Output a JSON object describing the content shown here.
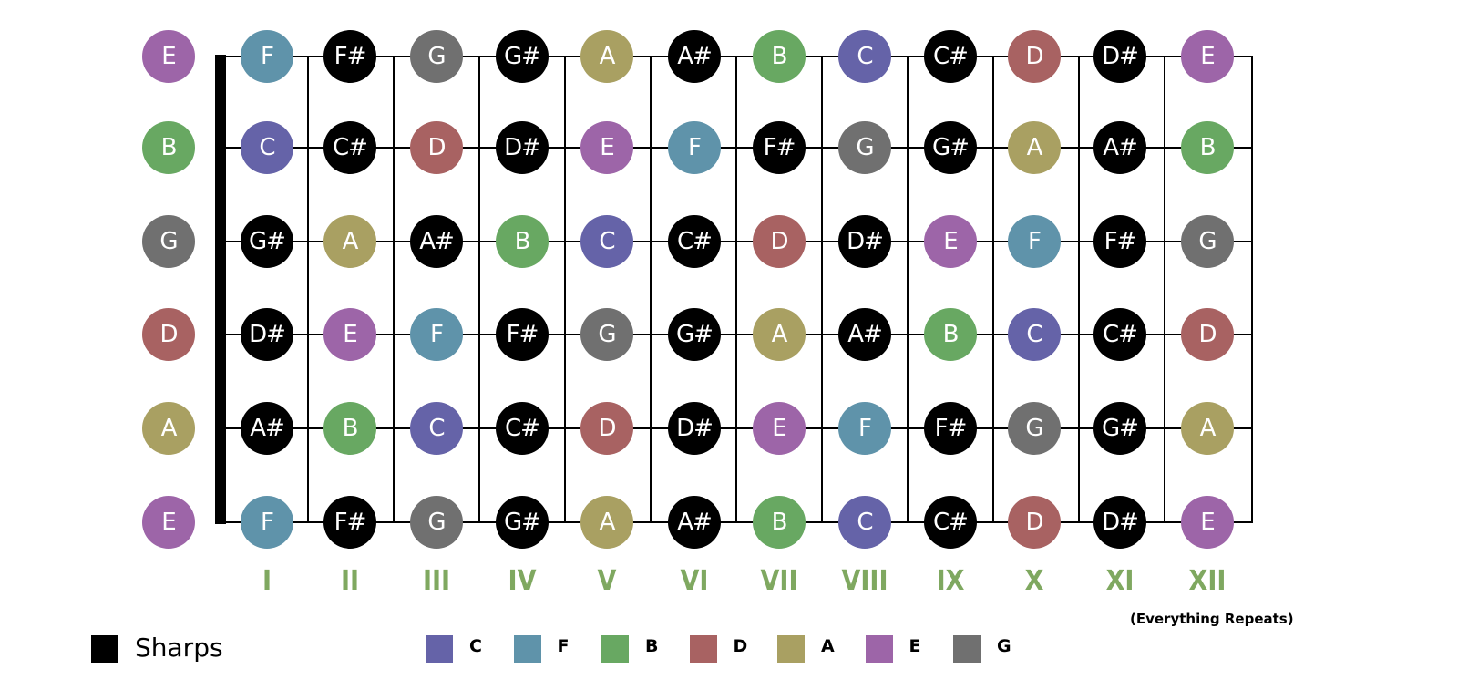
{
  "colors": {
    "C": "#6563a8",
    "F": "#5f93aa",
    "B": "#68a862",
    "D": "#a86262",
    "A": "#a9a062",
    "E": "#9d65a8",
    "G": "#707070",
    "sharp": "#000000",
    "fret_numeral": "#7fa860"
  },
  "open_strings": [
    "E",
    "B",
    "G",
    "D",
    "A",
    "E"
  ],
  "frets": [
    [
      "F",
      "F#",
      "G",
      "G#",
      "A",
      "A#",
      "B",
      "C",
      "C#",
      "D",
      "D#",
      "E"
    ],
    [
      "C",
      "C#",
      "D",
      "D#",
      "E",
      "F",
      "F#",
      "G",
      "G#",
      "A",
      "A#",
      "B"
    ],
    [
      "G#",
      "A",
      "A#",
      "B",
      "C",
      "C#",
      "D",
      "D#",
      "E",
      "F",
      "F#",
      "G"
    ],
    [
      "D#",
      "E",
      "F",
      "F#",
      "G",
      "G#",
      "A",
      "A#",
      "B",
      "C",
      "C#",
      "D"
    ],
    [
      "A#",
      "B",
      "C",
      "C#",
      "D",
      "D#",
      "E",
      "F",
      "F#",
      "G",
      "G#",
      "A"
    ],
    [
      "F",
      "F#",
      "G",
      "G#",
      "A",
      "A#",
      "B",
      "C",
      "C#",
      "D",
      "D#",
      "E"
    ]
  ],
  "fret_numbers": [
    "I",
    "II",
    "III",
    "IV",
    "V",
    "VI",
    "VII",
    "VIII",
    "IX",
    "X",
    "XI",
    "XII"
  ],
  "repeat_note": "(Everything Repeats)",
  "legend": {
    "sharps_label": "Sharps",
    "notes": [
      "C",
      "F",
      "B",
      "D",
      "A",
      "E",
      "G"
    ]
  }
}
